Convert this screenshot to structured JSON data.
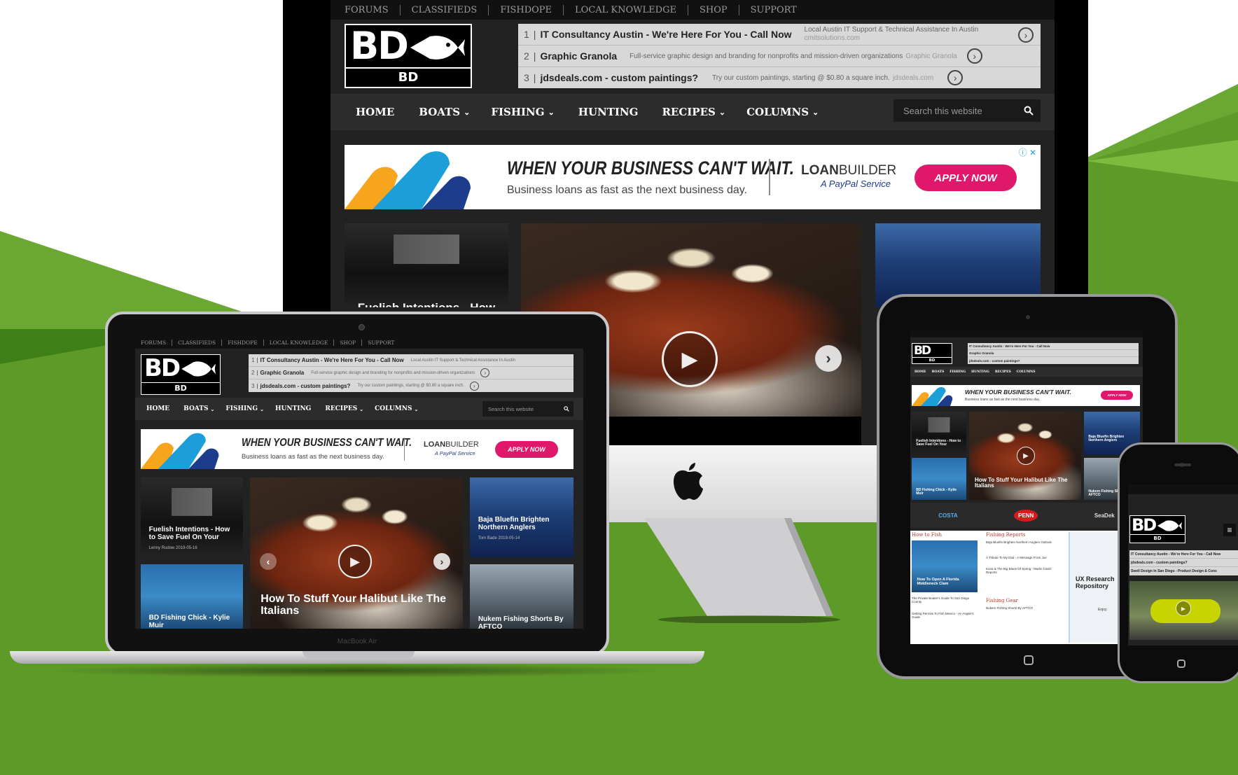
{
  "site": {
    "top_nav": [
      "FORUMS",
      "CLASSIFIEDS",
      "FISHDOPE",
      "LOCAL KNOWLEDGE",
      "SHOP",
      "SUPPORT"
    ],
    "logo_mark": "BD",
    "logo_url": "BD OUTDOORS.COM",
    "ads": [
      {
        "num": "1",
        "title": "IT Consultancy Austin - We're Here For You - Call Now",
        "desc": "Local Austin IT Support & Technical Assistance In Austin",
        "domain": "cmitsolutions.com"
      },
      {
        "num": "2",
        "title": "Graphic Granola",
        "desc": "Full-service graphic design and branding for nonprofits and mission-driven organizations",
        "domain": "Graphic Granola"
      },
      {
        "num": "3",
        "title": "jdsdeals.com - custom paintings?",
        "desc": "Try our custom paintings, starting @ $0.80 a square inch.",
        "domain": "jdsdeals.com"
      }
    ],
    "main_nav": [
      {
        "label": "HOME",
        "dropdown": false
      },
      {
        "label": "BOATS",
        "dropdown": true
      },
      {
        "label": "FISHING",
        "dropdown": true
      },
      {
        "label": "HUNTING",
        "dropdown": false
      },
      {
        "label": "RECIPES",
        "dropdown": true
      },
      {
        "label": "COLUMNS",
        "dropdown": true
      }
    ],
    "search_placeholder": "Search this website",
    "banner": {
      "headline": "WHEN YOUR BUSINESS CAN'T WAIT.",
      "subline": "Business loans as fast as the next business day.",
      "brand_loan": "LOAN",
      "brand_builder": "BUILDER",
      "brand_sub": "A PayPal Service",
      "cta": "APPLY NOW"
    },
    "tiles": {
      "fuel_title": "Fuelish Intentions - How to Save Fuel On Your",
      "fuel_meta": "Lenny Rudow 2019-05-16",
      "halibut_title": "How To Stuff Your Halibut Like The Italians",
      "bluefin_title": "Baja Bluefin Brighten Northern Anglers",
      "bluefin_meta": "Tom Bade 2019-05-14",
      "kylie_title": "BD Fishing Chick - Kylie Muir",
      "nukem_title": "Nukem Fishing Shorts By AFTCO"
    }
  },
  "laptop_label": "MacBook Air",
  "tablet": {
    "how_to_fish": "How to Fish",
    "fishing_reports": "Fishing Reports",
    "fishing_gear": "Fishing Gear",
    "report_items": [
      "Baja Bluefin Brighten Northern Anglers Outlook",
      "A Tribute To My Dad - A Message From Joe",
      "Kona & The Big Blues Of Spring - Marlin Catch Reports"
    ],
    "gear_items": [
      "Nukem Fishing Shorts By AFTCO"
    ],
    "howto_caption": "How To Open A Florida Middleneck Clam",
    "list_items": [
      "The Private Boater's Guide To San Diego County",
      "Getting Permits To Fish Mexico - An Angler's Guide"
    ],
    "brands": [
      "COSTA",
      "PENN",
      "SeaDek"
    ],
    "ux_ad": "UX Research Repository",
    "ux_brand": "Enjoy"
  },
  "phone": {
    "ads": [
      "IT Consultancy Austin - We're Here For You - Call Now",
      "jdsdeals.com - custom paintings?",
      "Swell Design In San Diego - Product Design & Cons"
    ]
  },
  "colors": {
    "green": "#5e9a28",
    "green_dark": "#4c8a1c",
    "accent_pink": "#e0186c"
  }
}
